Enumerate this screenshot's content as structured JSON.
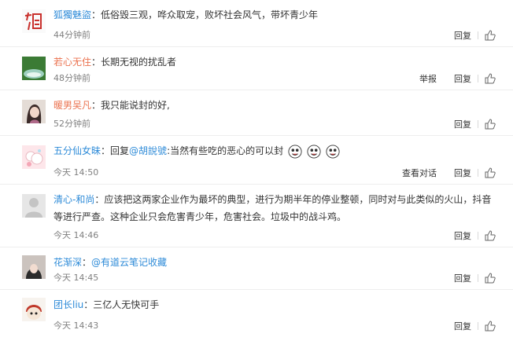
{
  "comments": [
    {
      "username": "狐獨魅盜",
      "text": "低俗毁三观，哗众取宠，败坏社会风气，带坏青少年",
      "time": "44分钟前",
      "actions": [
        "回复"
      ]
    },
    {
      "username": "若心无住",
      "text": "长期无视的扰乱者",
      "time": "48分钟前",
      "actions": [
        "举报",
        "回复"
      ]
    },
    {
      "username": "暖男吴凡",
      "text": "我只能说封的好,",
      "time": "52分钟前",
      "actions": [
        "回复"
      ]
    },
    {
      "username": "五分仙女昧",
      "reply_prefix": "回复",
      "mention": "@胡說號",
      "text": ":当然有些吃的恶心的可以封",
      "time": "今天 14:50",
      "actions": [
        "查看对话",
        "回复"
      ]
    },
    {
      "username": "清心-和尚",
      "text": "应该把这两家企业作为最坏的典型，进行为期半年的停业整顿，同时对与此类似的火山，抖音等进行严查。这种企业只会危害青少年，危害社会。垃圾中的战斗鸡。",
      "time": "今天 14:46",
      "actions": [
        "回复"
      ]
    },
    {
      "username": "花渐深",
      "mention": "@有道云笔记收藏",
      "text": "",
      "time": "今天 14:45",
      "actions": [
        "回复"
      ]
    },
    {
      "username": "团长liu",
      "text": "三亿人无快可手",
      "time": "今天 14:43",
      "actions": [
        "回复"
      ]
    }
  ],
  "colors": {
    "username": "#eb7350",
    "mention": "#2e8bd8",
    "meta": "#808080"
  }
}
